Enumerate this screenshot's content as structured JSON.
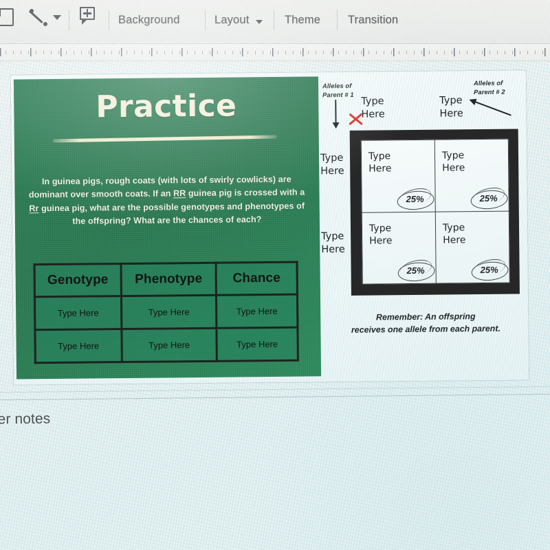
{
  "toolbar": {
    "icons": [
      {
        "name": "text-box-icon",
        "label": "Text box"
      },
      {
        "name": "line-tool-icon",
        "label": "Line"
      },
      {
        "name": "line-dropdown-caret-icon",
        "label": "Line options"
      },
      {
        "name": "add-comment-icon",
        "label": "Add comment"
      }
    ],
    "items": [
      {
        "label": "Background",
        "has_caret": false
      },
      {
        "label": "Layout",
        "has_caret": true
      },
      {
        "label": "Theme",
        "has_caret": false
      },
      {
        "label": "Transition",
        "has_caret": false
      }
    ]
  },
  "slide": {
    "title": "Practice",
    "body_part1": "In guinea pigs, rough coats (with lots of swirly cowlicks) are dominant over smooth coats. If an ",
    "body_dom": "RR",
    "body_part2": " guinea pig is crossed with a ",
    "body_het": "Rr",
    "body_part3": " guinea pig, what are the possible genotypes and phenotypes of the offspring? What are the chances of each?",
    "table": {
      "headers": [
        "Genotype",
        "Phenotype",
        "Chance"
      ],
      "rows": [
        [
          "Type Here",
          "Type Here",
          "Type Here"
        ],
        [
          "Type Here",
          "Type Here",
          "Type Here"
        ]
      ]
    },
    "punnett": {
      "parent1_label": "Alleles of\nParent # 1",
      "parent2_label": "Alleles of\nParent # 2",
      "cross_mark": "X",
      "column_headers": [
        "Type\nHere",
        "Type\nHere"
      ],
      "row_headers": [
        "Type\nHere",
        "Type\nHere"
      ],
      "cells": [
        {
          "text": "Type\nHere",
          "percent": "25%"
        },
        {
          "text": "Type\nHere",
          "percent": "25%"
        },
        {
          "text": "Type\nHere",
          "percent": "25%"
        },
        {
          "text": "Type\nHere",
          "percent": "25%"
        }
      ],
      "note": "Remember: An offspring\nreceives one allele from each parent."
    }
  },
  "notes": {
    "label": "ker notes"
  },
  "colors": {
    "slide_green": "#2a7a52",
    "title_cream": "#f2efd9",
    "frame_dark": "#272727",
    "red_x": "#d8342f",
    "toolbar_text": "#5b5f5e"
  }
}
